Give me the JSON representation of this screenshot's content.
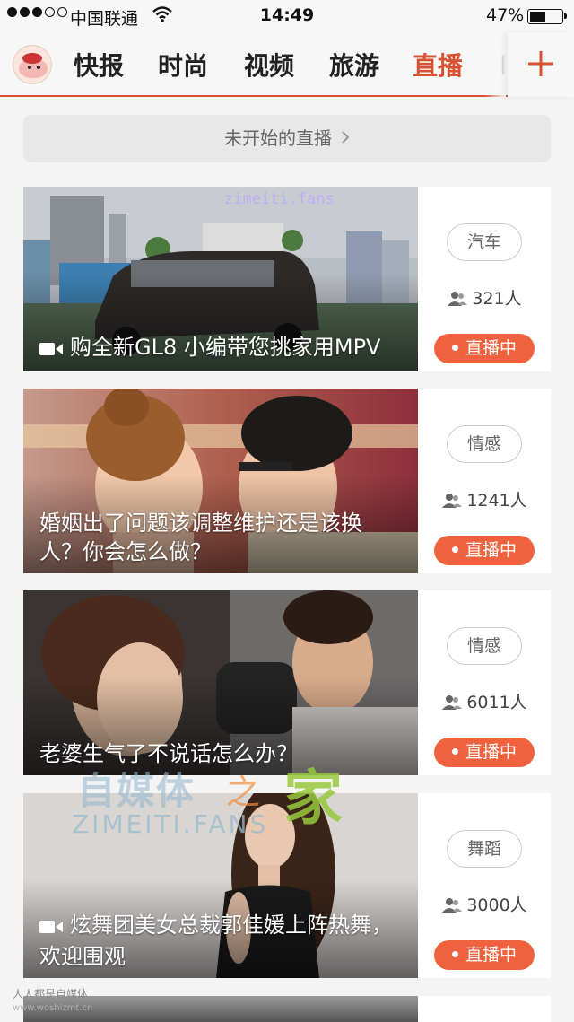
{
  "status_bar": {
    "carrier": "中国联通",
    "time": "14:49",
    "battery": "47%",
    "battery_level": 0.47
  },
  "header": {
    "tabs": [
      {
        "label": "快报",
        "active": false
      },
      {
        "label": "时尚",
        "active": false
      },
      {
        "label": "视频",
        "active": false
      },
      {
        "label": "旅游",
        "active": false
      },
      {
        "label": "直播",
        "active": true
      },
      {
        "label": "时",
        "active": false
      }
    ],
    "add_icon": "plus-icon",
    "accent_color": "#d9522f"
  },
  "not_started": {
    "label": "未开始的直播",
    "icon": "chevron-right-icon"
  },
  "cards": [
    {
      "title": "购全新GL8 小编带您挑家用MPV",
      "has_video_icon": true,
      "category": "汽车",
      "viewers": "321人",
      "status": "直播中"
    },
    {
      "title": "婚姻出了问题该调整维护还是该换人？你会怎么做？",
      "has_video_icon": false,
      "category": "情感",
      "viewers": "1241人",
      "status": "直播中"
    },
    {
      "title": "老婆生气了不说话怎么办？",
      "has_video_icon": false,
      "category": "情感",
      "viewers": "6011人",
      "status": "直播中"
    },
    {
      "title": "炫舞团美女总裁郭佳媛上阵热舞，欢迎围观",
      "has_video_icon": true,
      "category": "舞蹈",
      "viewers": "3000人",
      "status": "直播中"
    }
  ],
  "watermarks": {
    "top": "zimeiti.fans",
    "center_cn": "自媒体",
    "center_zhi": "之",
    "center_jia": "家",
    "center_en": "ZIMEITI.FANS",
    "bottom_cn": "人人都是自媒体",
    "bottom_url": "www.woshizmt.cn"
  },
  "live_color": "#f0623e"
}
